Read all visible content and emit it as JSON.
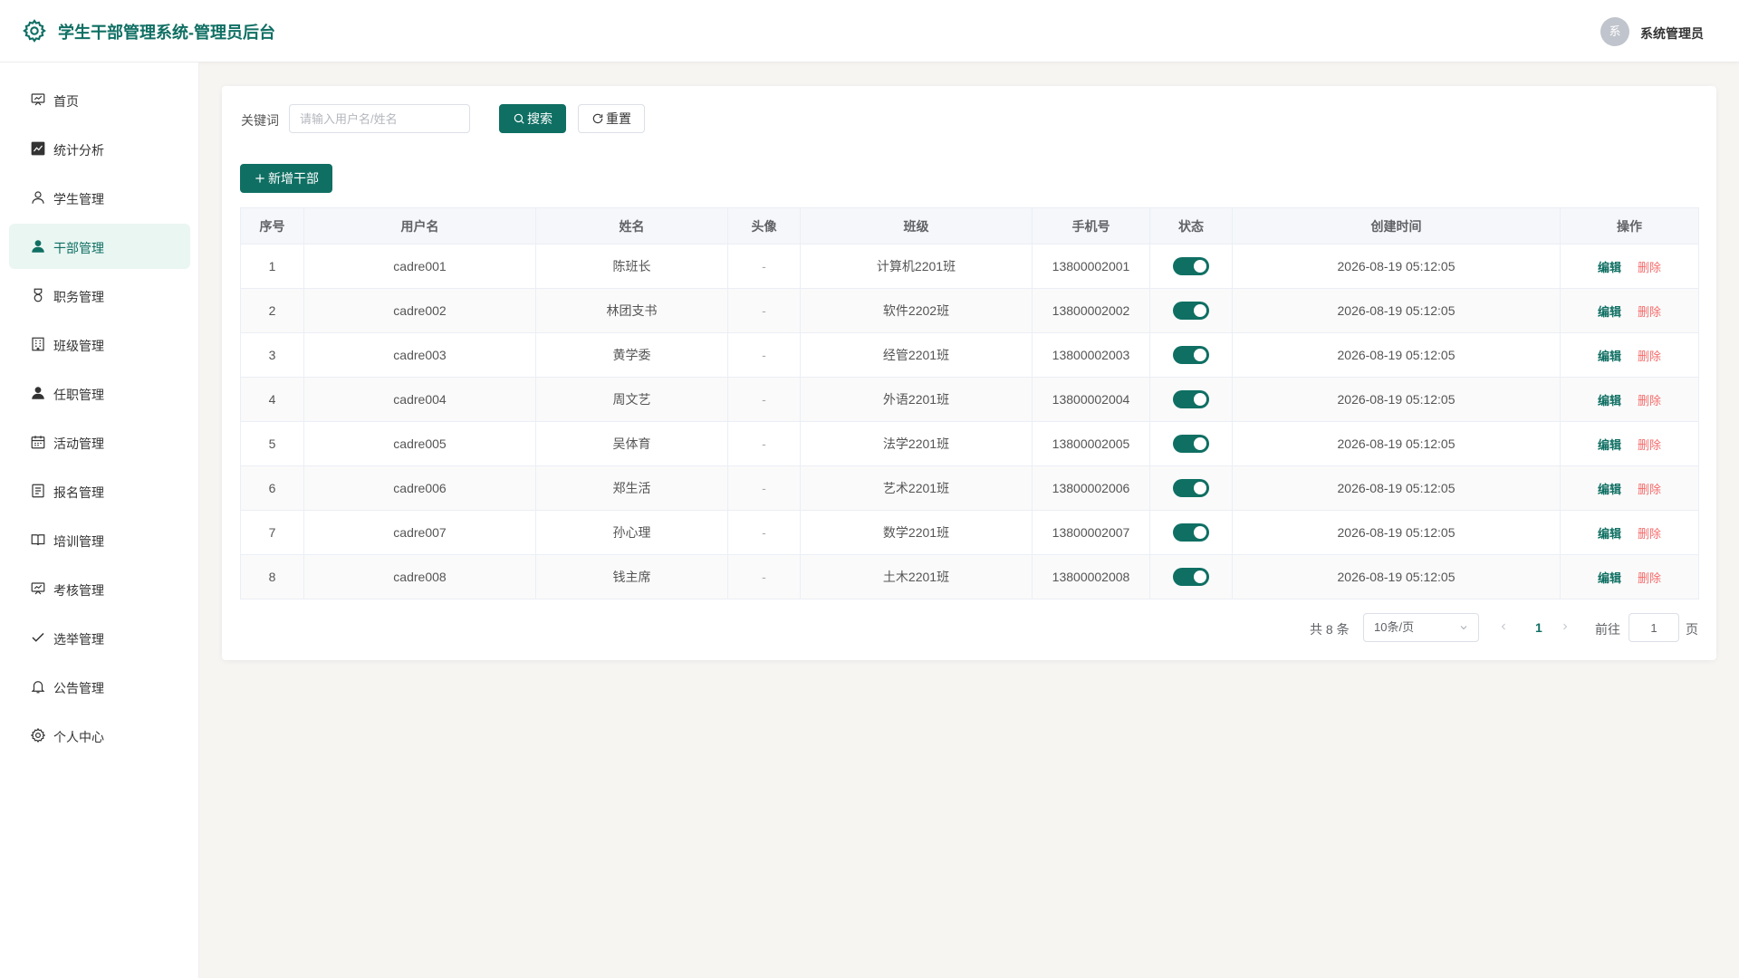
{
  "header": {
    "title": "学生干部管理系统-管理员后台",
    "avatar_text": "系",
    "user_name": "系统管理员",
    "accent": "#0f6f63"
  },
  "sidebar": {
    "items": [
      {
        "label": "首页",
        "icon": "presentation-icon"
      },
      {
        "label": "统计分析",
        "icon": "chart-icon"
      },
      {
        "label": "学生管理",
        "icon": "user-outline-icon"
      },
      {
        "label": "干部管理",
        "icon": "user-filled-icon",
        "active": true
      },
      {
        "label": "职务管理",
        "icon": "badge-icon"
      },
      {
        "label": "班级管理",
        "icon": "building-icon"
      },
      {
        "label": "任职管理",
        "icon": "user-filled-icon"
      },
      {
        "label": "活动管理",
        "icon": "calendar-icon"
      },
      {
        "label": "报名管理",
        "icon": "document-icon"
      },
      {
        "label": "培训管理",
        "icon": "book-icon"
      },
      {
        "label": "考核管理",
        "icon": "presentation-icon"
      },
      {
        "label": "选举管理",
        "icon": "check-icon"
      },
      {
        "label": "公告管理",
        "icon": "bell-icon"
      },
      {
        "label": "个人中心",
        "icon": "gear-icon"
      }
    ]
  },
  "search": {
    "label": "关键词",
    "placeholder": "请输入用户名/姓名",
    "value": "",
    "search_label": "搜索",
    "reset_label": "重置"
  },
  "toolbar": {
    "add_label": "新增干部"
  },
  "table": {
    "columns": [
      "序号",
      "用户名",
      "姓名",
      "头像",
      "班级",
      "手机号",
      "状态",
      "创建时间",
      "操作"
    ],
    "rows": [
      {
        "idx": "1",
        "username": "cadre001",
        "name": "陈班长",
        "avatar": "-",
        "class": "计算机2201班",
        "phone": "13800002001",
        "enabled": true,
        "created": "2026-08-19 05:12:05"
      },
      {
        "idx": "2",
        "username": "cadre002",
        "name": "林团支书",
        "avatar": "-",
        "class": "软件2202班",
        "phone": "13800002002",
        "enabled": true,
        "created": "2026-08-19 05:12:05"
      },
      {
        "idx": "3",
        "username": "cadre003",
        "name": "黄学委",
        "avatar": "-",
        "class": "经管2201班",
        "phone": "13800002003",
        "enabled": true,
        "created": "2026-08-19 05:12:05"
      },
      {
        "idx": "4",
        "username": "cadre004",
        "name": "周文艺",
        "avatar": "-",
        "class": "外语2201班",
        "phone": "13800002004",
        "enabled": true,
        "created": "2026-08-19 05:12:05"
      },
      {
        "idx": "5",
        "username": "cadre005",
        "name": "吴体育",
        "avatar": "-",
        "class": "法学2201班",
        "phone": "13800002005",
        "enabled": true,
        "created": "2026-08-19 05:12:05"
      },
      {
        "idx": "6",
        "username": "cadre006",
        "name": "郑生活",
        "avatar": "-",
        "class": "艺术2201班",
        "phone": "13800002006",
        "enabled": true,
        "created": "2026-08-19 05:12:05"
      },
      {
        "idx": "7",
        "username": "cadre007",
        "name": "孙心理",
        "avatar": "-",
        "class": "数学2201班",
        "phone": "13800002007",
        "enabled": true,
        "created": "2026-08-19 05:12:05"
      },
      {
        "idx": "8",
        "username": "cadre008",
        "name": "钱主席",
        "avatar": "-",
        "class": "土木2201班",
        "phone": "13800002008",
        "enabled": true,
        "created": "2026-08-19 05:12:05"
      }
    ],
    "edit_label": "编辑",
    "delete_label": "删除"
  },
  "pagination": {
    "total_text": "共 8 条",
    "page_size": "10条/页",
    "current_page": "1",
    "goto_label": "前往",
    "goto_value": "1",
    "page_unit": "页"
  }
}
